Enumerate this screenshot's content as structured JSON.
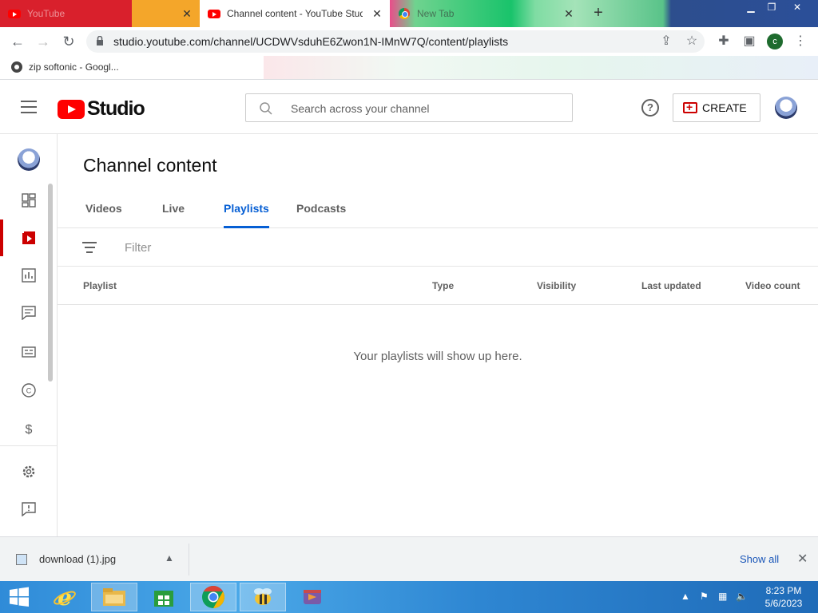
{
  "browser": {
    "tabs": [
      {
        "title": "YouTube",
        "icon": "youtube-icon",
        "active": false
      },
      {
        "title": "Channel content - YouTube Studio",
        "icon": "youtube-icon",
        "active": true
      },
      {
        "title": "New Tab",
        "icon": "chrome-icon",
        "active": false
      }
    ],
    "new_tab": "+",
    "url": "studio.youtube.com/channel/UCDWVsduhE6Zwon1N-IMnW7Q/content/playlists",
    "profile_initial": "c",
    "bookmarks": [
      {
        "label": "zip softonic - Googl...",
        "icon": "google-icon"
      }
    ]
  },
  "studio": {
    "logo_text": "Studio",
    "search_placeholder": "Search across your channel",
    "help": "?",
    "create_label": "CREATE",
    "page_title": "Channel content",
    "tabs": [
      {
        "label": "Videos",
        "active": false
      },
      {
        "label": "Live",
        "active": false
      },
      {
        "label": "Playlists",
        "active": true
      },
      {
        "label": "Podcasts",
        "active": false
      }
    ],
    "filter_placeholder": "Filter",
    "columns": [
      "Playlist",
      "Type",
      "Visibility",
      "Last updated",
      "Video count"
    ],
    "empty_message": "Your playlists will show up here.",
    "sidebar_items": [
      {
        "name": "dashboard-icon",
        "active": false
      },
      {
        "name": "content-icon",
        "active": true
      },
      {
        "name": "analytics-icon",
        "active": false
      },
      {
        "name": "comments-icon",
        "active": false
      },
      {
        "name": "subtitles-icon",
        "active": false
      },
      {
        "name": "copyright-icon",
        "active": false
      },
      {
        "name": "earn-icon",
        "active": false
      },
      {
        "name": "settings-icon",
        "active": false
      },
      {
        "name": "feedback-icon",
        "active": false
      }
    ],
    "accent_color": "#065fd4",
    "brand_color": "#ff0000"
  },
  "downloads": {
    "file_name": "download (1).jpg",
    "show_all": "Show all"
  },
  "taskbar": {
    "time": "8:23 PM",
    "date": "5/6/2023",
    "apps": [
      "start-icon",
      "internet-explorer-icon",
      "file-explorer-icon",
      "store-icon",
      "chrome-icon",
      "bee-app-icon",
      "media-app-icon"
    ]
  }
}
